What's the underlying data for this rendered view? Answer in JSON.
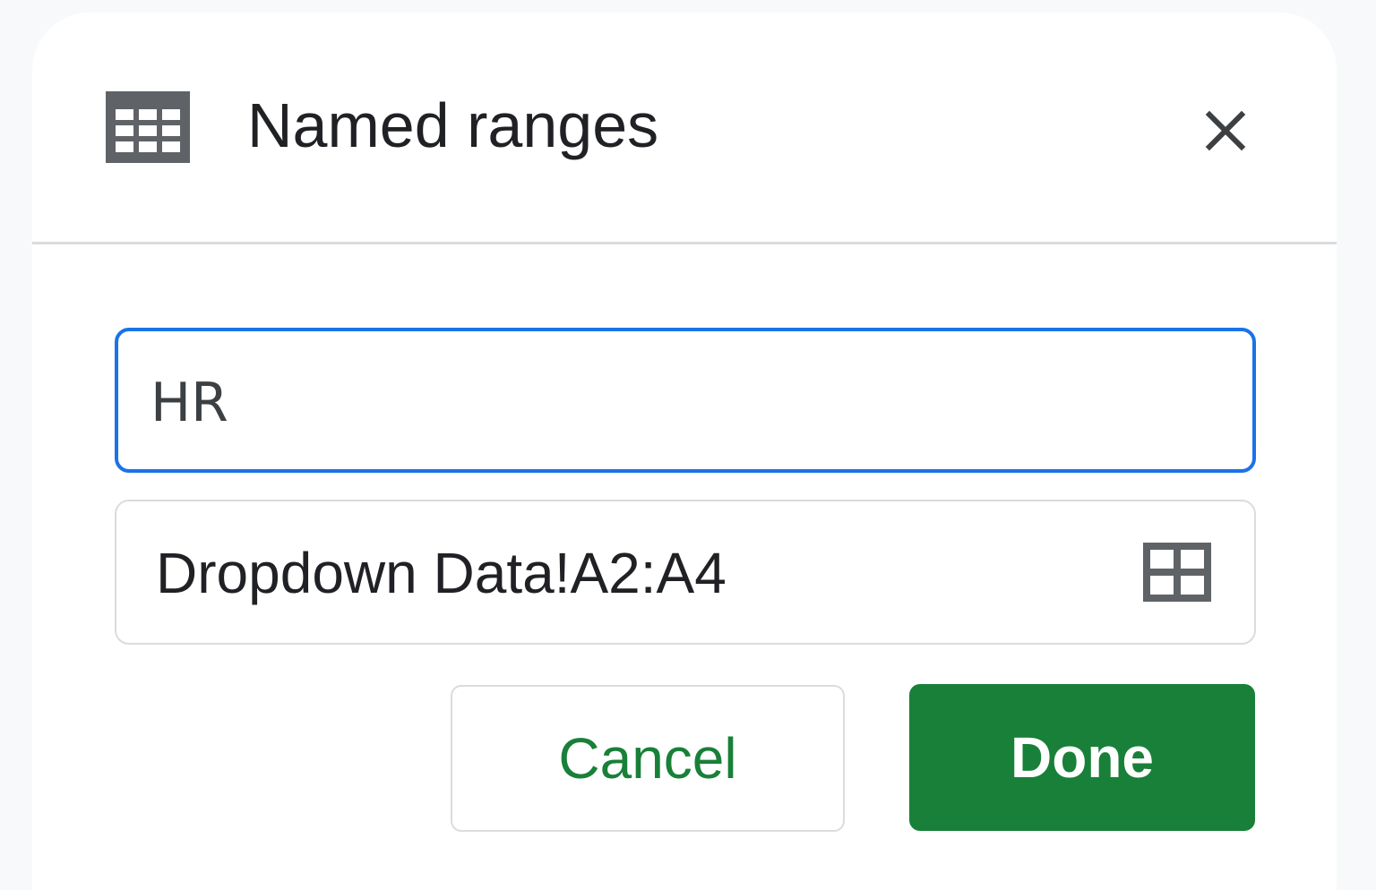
{
  "dialog": {
    "title": "Named ranges",
    "header_icon": "table-icon",
    "close_icon": "close-icon"
  },
  "form": {
    "name_value": "HR",
    "range_value": "Dropdown Data!A2:A4",
    "range_icon": "grid-select-icon"
  },
  "actions": {
    "cancel_label": "Cancel",
    "done_label": "Done"
  },
  "colors": {
    "accent_blue": "#1a73e8",
    "primary_green": "#188038",
    "icon_gray": "#5f6368",
    "border_gray": "#dadce0"
  }
}
